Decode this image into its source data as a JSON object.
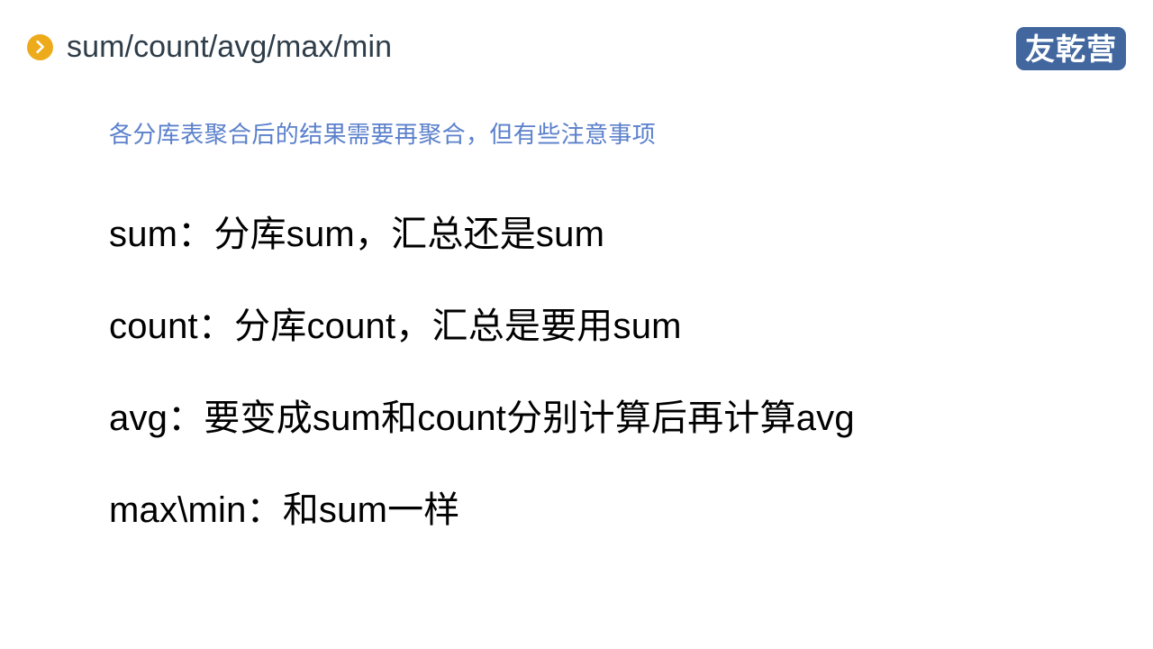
{
  "slide": {
    "header": {
      "bullet_icon": "chevron-right-circle-icon",
      "title": "sum/count/avg/max/min",
      "title_color": "#2e3d49",
      "bullet_color": "#edab1c"
    },
    "brand": {
      "logo_text": "友乾营",
      "logo_bg": "#42679f",
      "logo_text_color": "#ffffff"
    },
    "subtitle": {
      "text": "各分库表聚合后的结果需要再聚合，但有些注意事项",
      "color": "#5b80cb"
    },
    "body": {
      "lines": [
        {
          "text": "sum：分库sum，汇总还是sum"
        },
        {
          "text": "count：分库count，汇总是要用sum"
        },
        {
          "text": "avg：要变成sum和count分别计算后再计算avg"
        },
        {
          "text": "max\\min：和sum一样"
        }
      ]
    },
    "background_color": "#ffffff"
  }
}
